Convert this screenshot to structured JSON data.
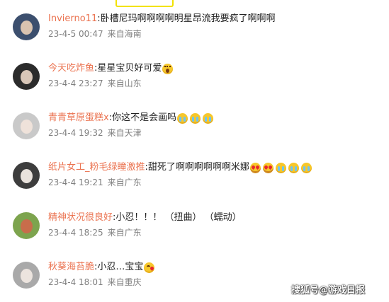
{
  "comments": [
    {
      "username": "Invierno11",
      "separator": ":",
      "text": "卧槽尼玛啊啊啊啊明星昂流我要疯了啊啊啊",
      "emojis": [],
      "time": "23-4-5 00:47",
      "source": "来自海南",
      "avatar_colors": [
        "#3c4f6e",
        "#d9c3b0"
      ]
    },
    {
      "username": "今天吃炸鱼",
      "separator": ":",
      "text": "星星宝贝好可爱",
      "emojis": [
        "scream-emoji"
      ],
      "time": "23-4-4 23:27",
      "source": "来自山东",
      "avatar_colors": [
        "#2b2b2b",
        "#d8c6b8"
      ]
    },
    {
      "username": "青青草原蛋糕x",
      "separator": ":",
      "text": "你这不是会画吗",
      "emojis": [
        "cry-emoji",
        "cry-emoji",
        "cry-emoji"
      ],
      "time": "23-4-4 19:32",
      "source": "来自天津",
      "avatar_colors": [
        "#c9c9c9",
        "#efe2da"
      ]
    },
    {
      "username": "纸片女工_粉毛绿瞳激推",
      "separator": ":",
      "text": "甜死了啊啊啊啊啊啊米娜",
      "emojis": [
        "heart-eyes-emoji",
        "heart-eyes-emoji",
        "cry-emoji",
        "cry-emoji",
        "cry-emoji"
      ],
      "time": "23-4-4 19:21",
      "source": "来自广东",
      "avatar_colors": [
        "#3d3d3d",
        "#e9e2dc"
      ]
    },
    {
      "username": "精神状况很良好",
      "separator": ":",
      "text": "小忍！！！ （扭曲） （蠕动）",
      "emojis": [],
      "time": "23-4-4 18:25",
      "source": "来自广东",
      "avatar_colors": [
        "#7da44e",
        "#c86d4b"
      ]
    },
    {
      "username": "秋葵海苔脆",
      "separator": ":",
      "text": "小忍…宝宝",
      "emojis": [
        "kiss-emoji"
      ],
      "time": "23-4-4 18:01",
      "source": "来自重庆",
      "avatar_colors": [
        "#a9a9a9",
        "#ece4de"
      ]
    }
  ],
  "watermark": "搜狐号@游戏日报"
}
